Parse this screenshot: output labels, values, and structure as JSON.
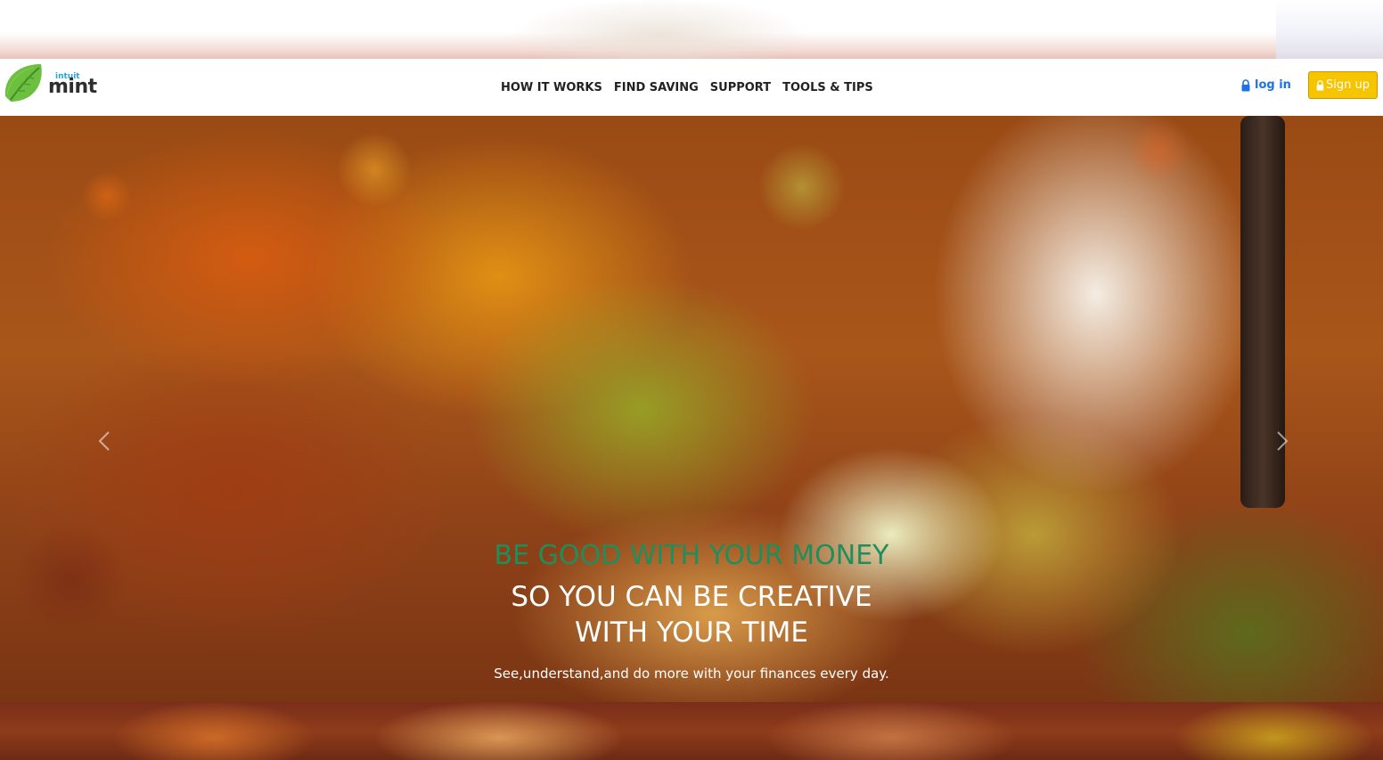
{
  "brand": {
    "small": "intuit",
    "name": "mint"
  },
  "nav": {
    "links": [
      "HOW IT WORKS",
      "FIND SAVING",
      "SUPPORT",
      "TOOLS & TIPS"
    ],
    "login": "log in",
    "signup": "Sign up"
  },
  "hero": {
    "headline_green": "BE GOOD WITH YOUR MONEY",
    "headline_white_1": "SO YOU CAN BE CREATIVE",
    "headline_white_2": "WITH YOUR TIME",
    "subtext": "See,understand,and do more with your finances every day."
  },
  "colors": {
    "accent_green": "#1e8f5c",
    "link_blue": "#1a73e8",
    "signup_yellow": "#f7c400"
  },
  "icons": [
    "leaf-logo-icon",
    "lock-icon",
    "chevron-left-icon",
    "chevron-right-icon"
  ]
}
